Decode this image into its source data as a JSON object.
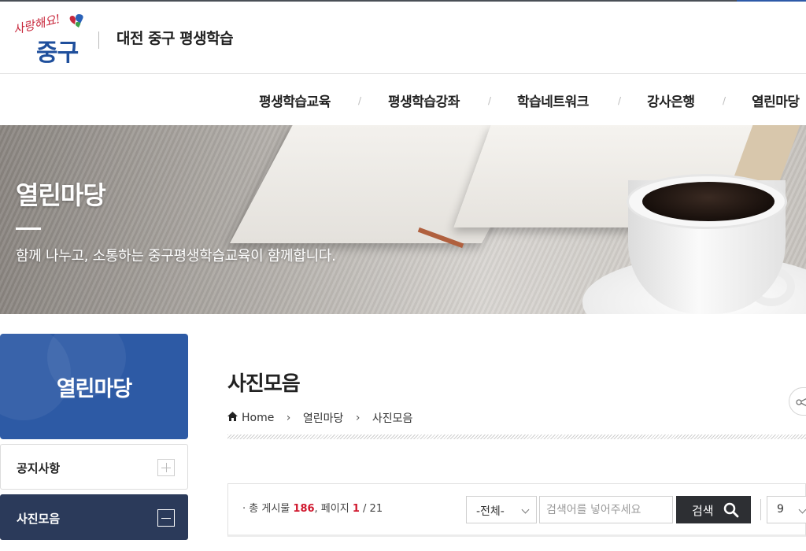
{
  "header": {
    "logo_slogan": "사랑해요!",
    "logo_text": "중구",
    "site_title": "대전 중구 평생학습"
  },
  "gnb": {
    "items": [
      {
        "label": "평생학습교육"
      },
      {
        "label": "평생학습강좌"
      },
      {
        "label": "학습네트워크"
      },
      {
        "label": "강사은행"
      },
      {
        "label": "열린마당"
      }
    ],
    "separator": "/"
  },
  "banner": {
    "title": "열린마당",
    "subtitle": "함께 나누고, 소통하는 중구평생학습교육이 함께합니다."
  },
  "sidebar": {
    "title": "열린마당",
    "items": [
      {
        "label": "공지사항",
        "state": "collapsed"
      },
      {
        "label": "사진모음",
        "state": "expanded"
      }
    ]
  },
  "content": {
    "page_title": "사진모음",
    "breadcrumb": {
      "home": "Home",
      "arrow": "›",
      "level1": "열린마당",
      "level2": "사진모음"
    }
  },
  "board": {
    "bullet": "·",
    "total_label": "총 게시물",
    "total_count": "186",
    "page_label": ", 페이지",
    "current_page": "1",
    "total_pages": "/ 21",
    "category_select": "-전체-",
    "search_placeholder": "검색어를 넣어주세요",
    "search_button": "검색",
    "page_size": "9"
  },
  "colors": {
    "brand_blue": "#2d5aa5",
    "active_navy": "#2b3a5a",
    "highlight_red": "#d0182e",
    "button_dark": "#2d2f33"
  }
}
